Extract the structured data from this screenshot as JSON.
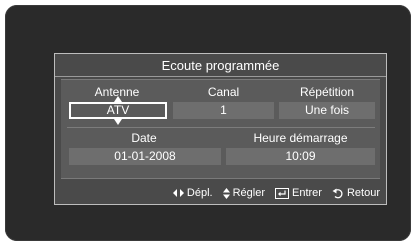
{
  "dialog": {
    "title": "Ecoute programmée"
  },
  "fields": {
    "antenne": {
      "label": "Antenne",
      "value": "ATV"
    },
    "canal": {
      "label": "Canal",
      "value": "1"
    },
    "repetition": {
      "label": "Répétition",
      "value": "Une fois"
    },
    "date": {
      "label": "Date",
      "value": "01-01-2008"
    },
    "heure": {
      "label": "Heure démarrage",
      "value": "10:09"
    }
  },
  "footer": {
    "move": "Dépl.",
    "adjust": "Régler",
    "enter": "Entrer",
    "back": "Retour"
  },
  "icons": {
    "move": "left-right-arrows-icon",
    "adjust": "up-down-arrows-icon",
    "enter": "enter-key-icon",
    "back": "return-arrow-icon"
  }
}
